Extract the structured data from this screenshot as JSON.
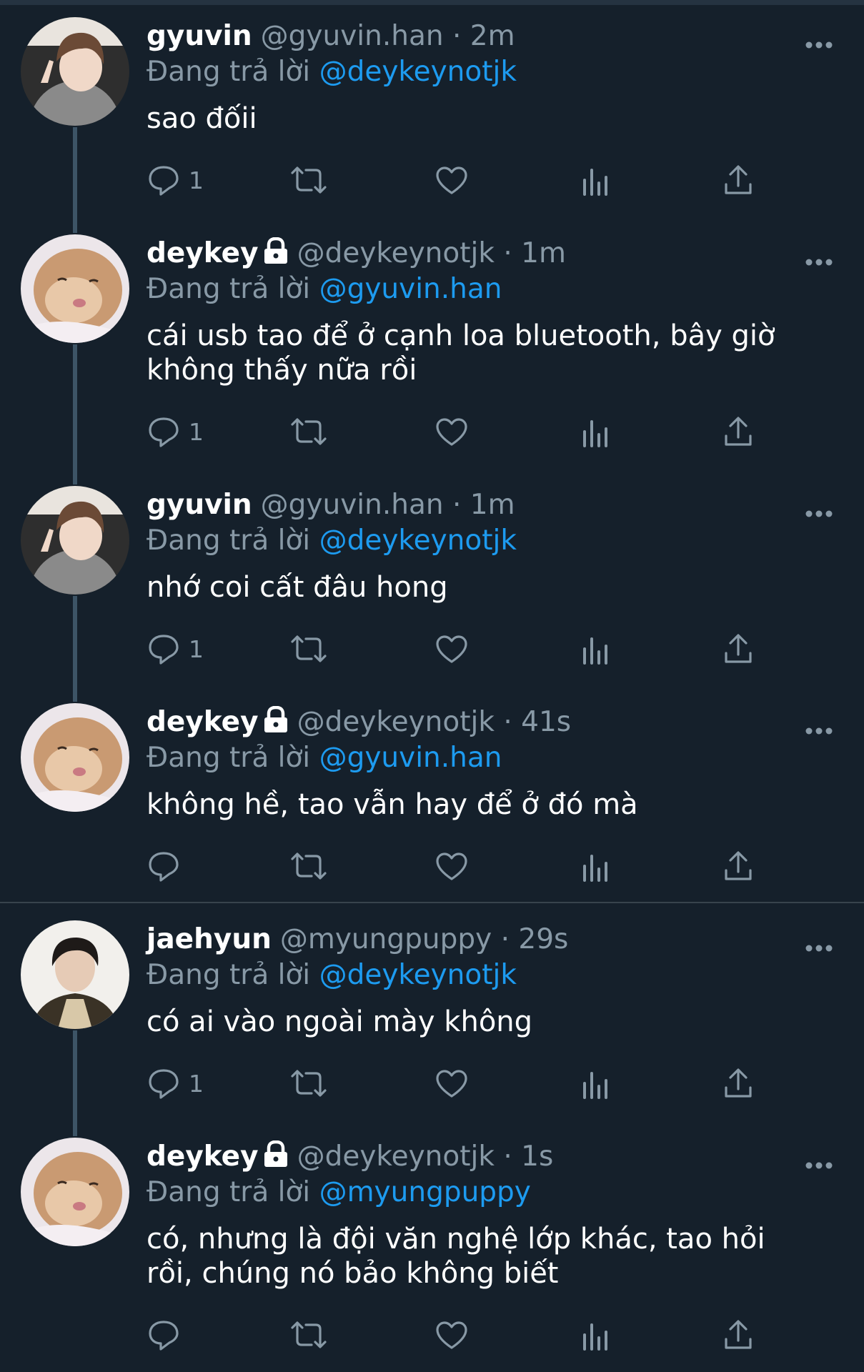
{
  "colors": {
    "background": "#15202b",
    "primary_text": "#ffffff",
    "secondary_text": "#8899a6",
    "mention": "#1d9bf0",
    "thread_line": "#3d5466",
    "divider": "#38444d"
  },
  "tweets": [
    {
      "name": "gyuvin",
      "handle": "@gyuvin.han",
      "time": "· 2m",
      "reply_prefix": "Đang trả lời",
      "reply_to": "@deykeynotjk",
      "text": "sao đốii",
      "reply_count": "1",
      "protected": false,
      "avatar": "gyuvin-avatar"
    },
    {
      "name": "deykey",
      "handle": "@deykeynotjk",
      "time": "· 1m",
      "reply_prefix": "Đang trả lời",
      "reply_to": "@gyuvin.han",
      "text": "cái usb tao để ở cạnh loa bluetooth, bây giờ không thấy nữa rồi",
      "reply_count": "1",
      "protected": true,
      "avatar": "hamster-avatar"
    },
    {
      "name": "gyuvin",
      "handle": "@gyuvin.han",
      "time": "· 1m",
      "reply_prefix": "Đang trả lời",
      "reply_to": "@deykeynotjk",
      "text": "nhớ coi cất đâu hong",
      "reply_count": "1",
      "protected": false,
      "avatar": "gyuvin-avatar"
    },
    {
      "name": "deykey",
      "handle": "@deykeynotjk",
      "time": "· 41s",
      "reply_prefix": "Đang trả lời",
      "reply_to": "@gyuvin.han",
      "text": "không hề, tao vẫn hay để ở đó mà",
      "reply_count": "",
      "protected": true,
      "avatar": "hamster-avatar"
    },
    {
      "name": "jaehyun",
      "handle": "@myungpuppy",
      "time": "· 29s",
      "reply_prefix": "Đang trả lời",
      "reply_to": "@deykeynotjk",
      "text": "có ai vào ngoài mày không",
      "reply_count": "1",
      "protected": false,
      "avatar": "jaehyun-avatar"
    },
    {
      "name": "deykey",
      "handle": "@deykeynotjk",
      "time": "· 1s",
      "reply_prefix": "Đang trả lời",
      "reply_to": "@myungpuppy",
      "text": "có, nhưng là đội văn nghệ lớp khác, tao hỏi rồi, chúng nó bảo không biết",
      "reply_count": "",
      "protected": true,
      "avatar": "hamster-avatar"
    }
  ]
}
